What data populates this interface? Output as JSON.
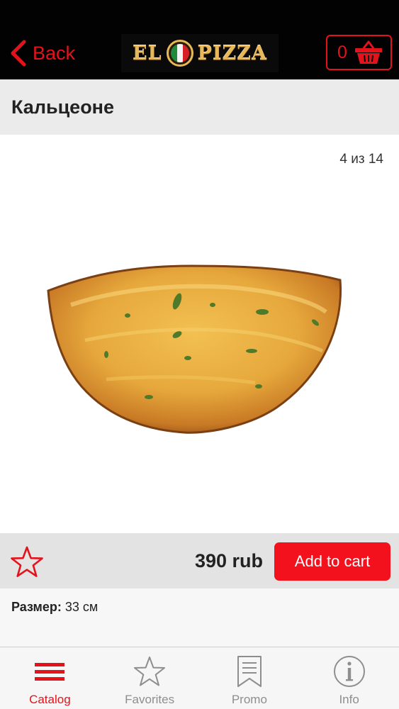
{
  "header": {
    "back_label": "Back",
    "logo": {
      "left": "EL",
      "right": "PIZZA"
    },
    "cart_count": "0"
  },
  "product": {
    "title": "Кальцеоне",
    "pager": "4 из 14",
    "price": "390 rub",
    "add_to_cart_label": "Add to cart",
    "spec_key": "Размер:",
    "spec_value": " 33 см"
  },
  "tabs": [
    {
      "label": "Catalog",
      "icon": "menu-lines-icon",
      "active": true
    },
    {
      "label": "Favorites",
      "icon": "star-icon",
      "active": false
    },
    {
      "label": "Promo",
      "icon": "bookmark-icon",
      "active": false
    },
    {
      "label": "Info",
      "icon": "info-icon",
      "active": false
    }
  ],
  "colors": {
    "accent": "#e3121b",
    "header_bg": "#020202",
    "logo_gold": "#e7b95a",
    "inactive_tab": "#8e8e8e"
  }
}
